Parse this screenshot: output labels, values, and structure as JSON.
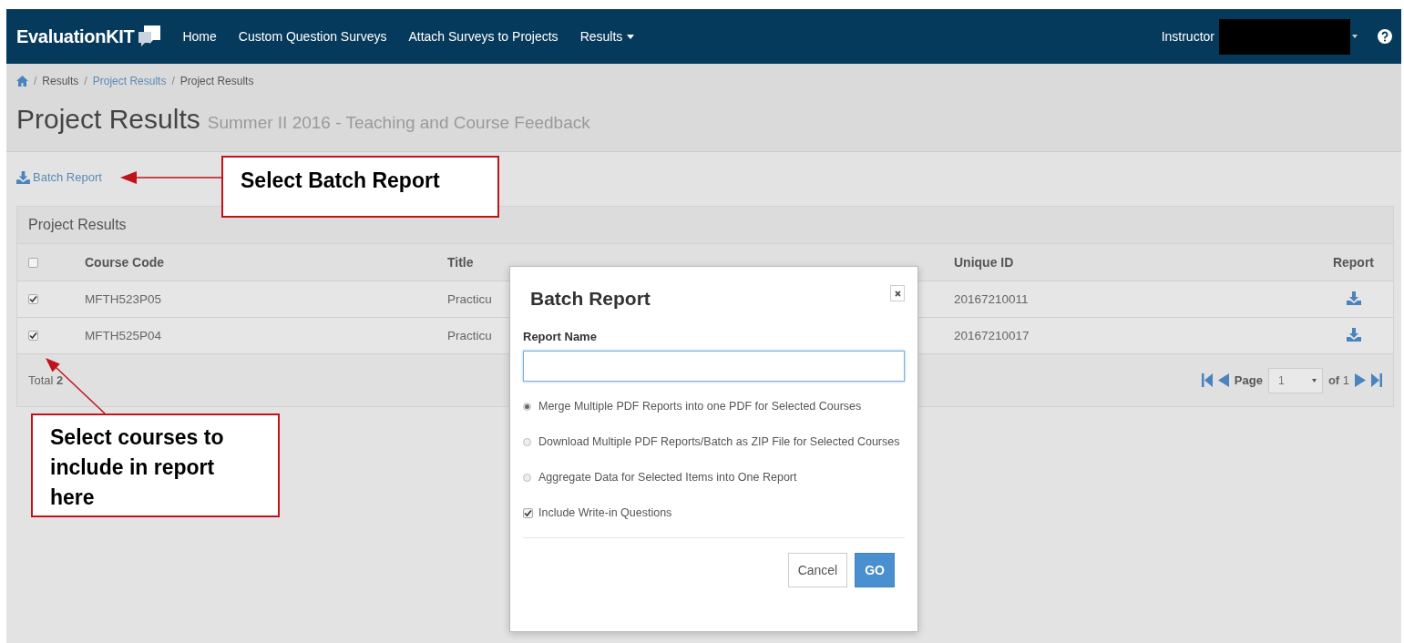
{
  "navbar": {
    "brand": "EvaluationKIT",
    "links": [
      {
        "label": "Home",
        "dropdown": false
      },
      {
        "label": "Custom Question Surveys",
        "dropdown": false
      },
      {
        "label": "Attach Surveys to Projects",
        "dropdown": false
      },
      {
        "label": "Results",
        "dropdown": true
      }
    ],
    "user_label": "Instructor"
  },
  "breadcrumb": [
    {
      "separator": "/",
      "label": "Results",
      "link": false
    },
    {
      "separator": "/",
      "label": "Project Results",
      "link": true
    },
    {
      "separator": "/",
      "label": "Project Results",
      "link": false
    }
  ],
  "page_title": "Project Results",
  "page_subtitle": "Summer II 2016 - Teaching and Course Feedback",
  "toolbar": {
    "batch_report_link": "Batch Report"
  },
  "panel": {
    "title": "Project Results",
    "select_all_checked": false,
    "columns": [
      "Course Code",
      "Title",
      "Unique ID",
      "Report"
    ],
    "rows": [
      {
        "checked": true,
        "course_code": "MFTH523P05",
        "title": "Practicu",
        "unique_id": "20167210011"
      },
      {
        "checked": true,
        "course_code": "MFTH525P04",
        "title": "Practicu",
        "unique_id": "20167210017"
      }
    ],
    "total": "Total **2**",
    "pagination": {
      "page_label": "Page",
      "page": "1",
      "of_label": "**of** 1"
    }
  },
  "dialog": {
    "title": "Batch Report",
    "field_label": "Report Name",
    "options": [
      {
        "kind": "radio",
        "label": "Merge Multiple PDF Reports into one PDF for Selected Courses",
        "selected": true
      },
      {
        "kind": "radio",
        "label": "Download Multiple PDF Reports/Batch as ZIP File for Selected Courses",
        "selected": false
      },
      {
        "kind": "radio",
        "label": "Aggregate Data for Selected Items into One Report",
        "selected": false
      },
      {
        "kind": "checkbox",
        "label": "Include Write-in Questions",
        "checked": true
      }
    ],
    "buttons": [
      {
        "label": "Cancel",
        "kind": "default"
      },
      {
        "label": "GO",
        "kind": "primary"
      }
    ]
  },
  "annotations": [
    {
      "text": "Select Batch Report"
    },
    {
      "text": "Select courses to include in report here"
    }
  ]
}
